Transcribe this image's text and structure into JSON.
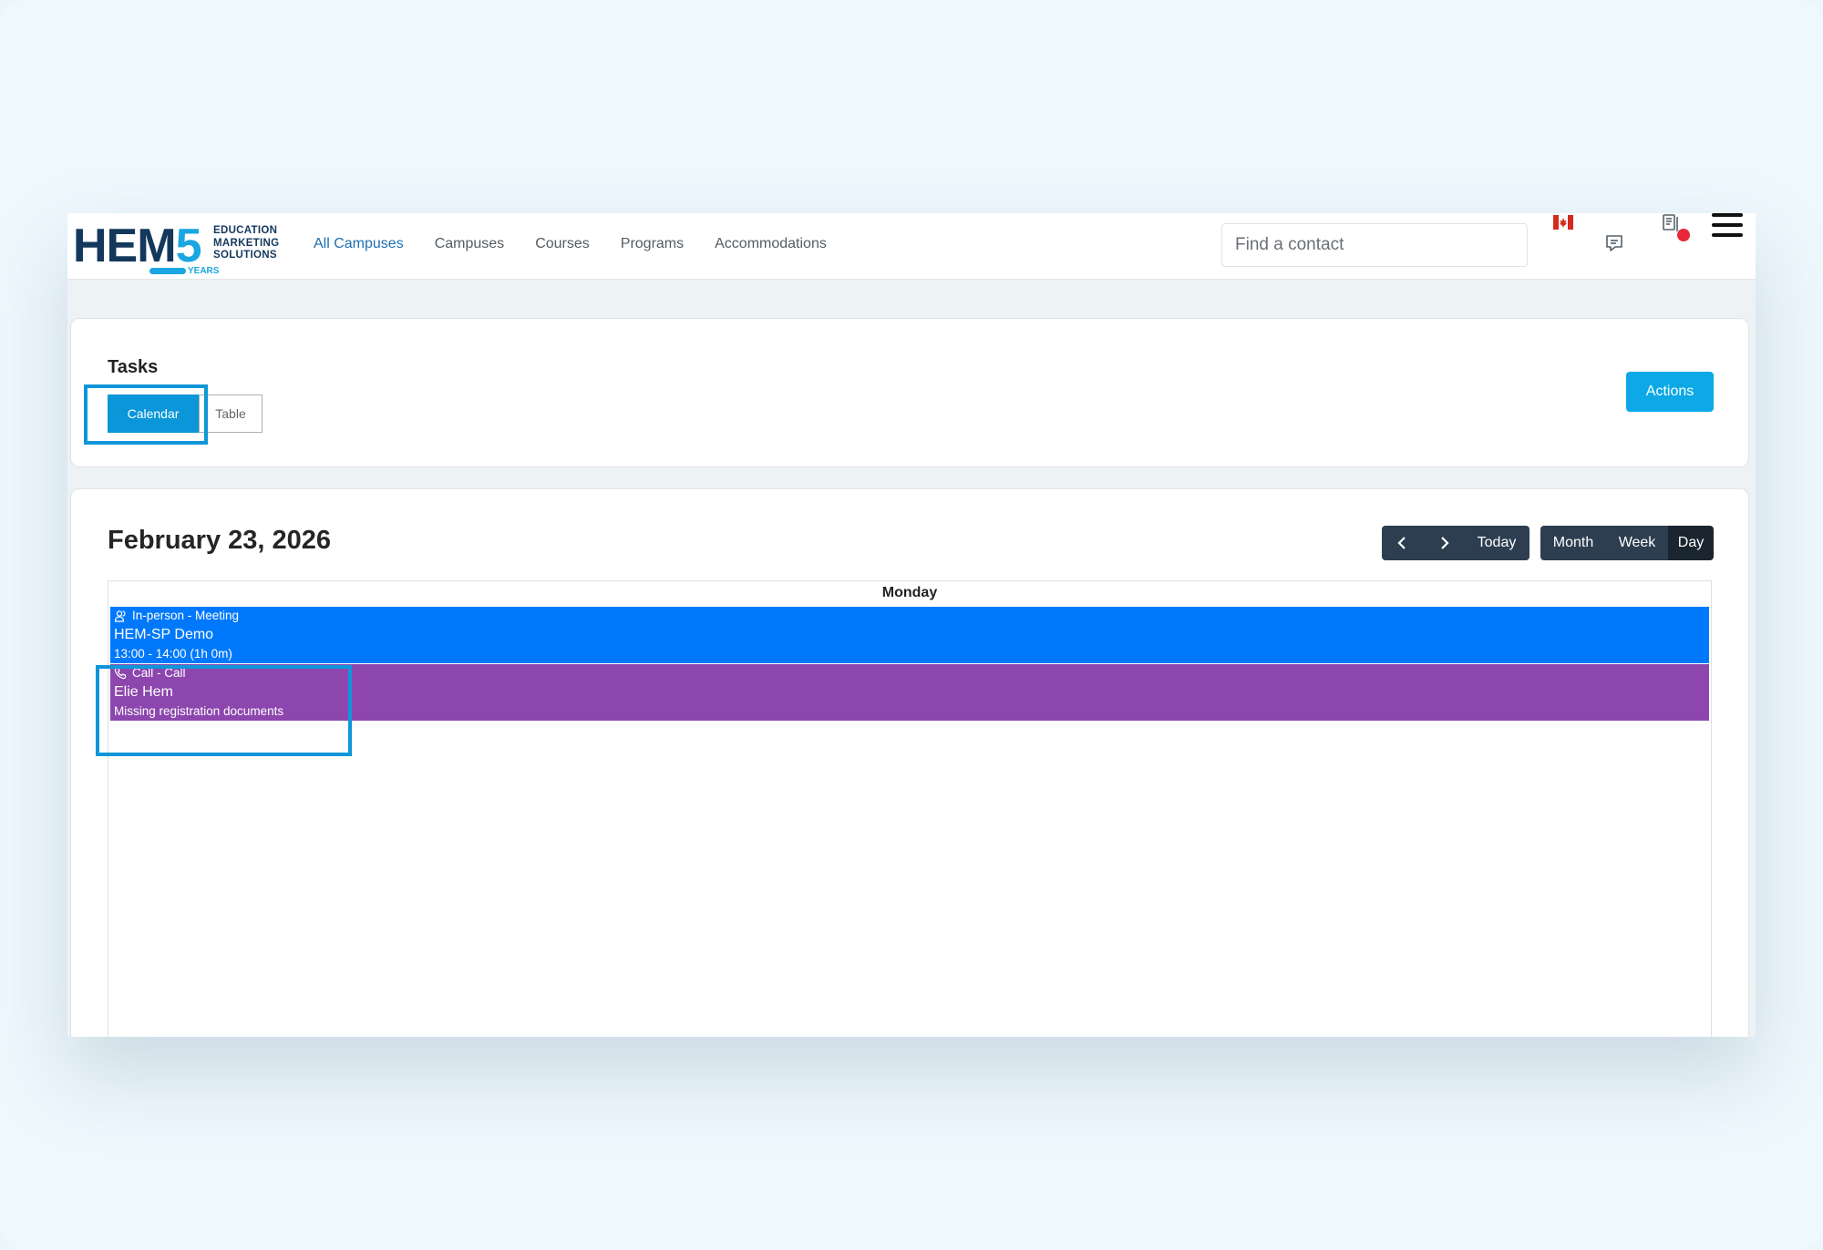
{
  "brand": {
    "logo_text": "HEM",
    "logo_number": "5",
    "logo_line1": "EDUCATION",
    "logo_line2": "MARKETING",
    "logo_line3": "SOLUTIONS",
    "logo_years": "YEARS",
    "primary_color": "#14385c",
    "accent_color": "#1aa6e0"
  },
  "nav": {
    "items": [
      {
        "label": "All Campuses",
        "active": true
      },
      {
        "label": "Campuses",
        "active": false
      },
      {
        "label": "Courses",
        "active": false
      },
      {
        "label": "Programs",
        "active": false
      },
      {
        "label": "Accommodations",
        "active": false
      }
    ]
  },
  "search": {
    "placeholder": "Find a contact"
  },
  "header_icons": [
    "canada-flag-icon",
    "message-icon",
    "document-icon",
    "notification-dot",
    "hamburger-menu-icon"
  ],
  "tasks": {
    "title": "Tasks",
    "views": [
      {
        "label": "Calendar",
        "selected": true
      },
      {
        "label": "Table",
        "selected": false
      }
    ],
    "actions_label": "Actions"
  },
  "calendar": {
    "date_title": "February 23, 2026",
    "prev_icon": "chevron-left-icon",
    "next_icon": "chevron-right-icon",
    "today_label": "Today",
    "views": [
      "Month",
      "Week",
      "Day"
    ],
    "selected_view": "Day",
    "day_header": "Monday",
    "events": [
      {
        "icon": "meeting-icon",
        "type": "In-person - Meeting",
        "title": "HEM-SP Demo",
        "detail": "13:00 - 14:00 (1h 0m)",
        "color": "#0078fb"
      },
      {
        "icon": "phone-icon",
        "type": "Call - Call",
        "title": "Elie Hem",
        "detail": "Missing registration documents",
        "color": "#8c46ae"
      }
    ]
  },
  "colors": {
    "primary_button": "#0a96d8",
    "highlight_outline": "#0f96d9",
    "toolbar_dark": "#2c3e50"
  }
}
